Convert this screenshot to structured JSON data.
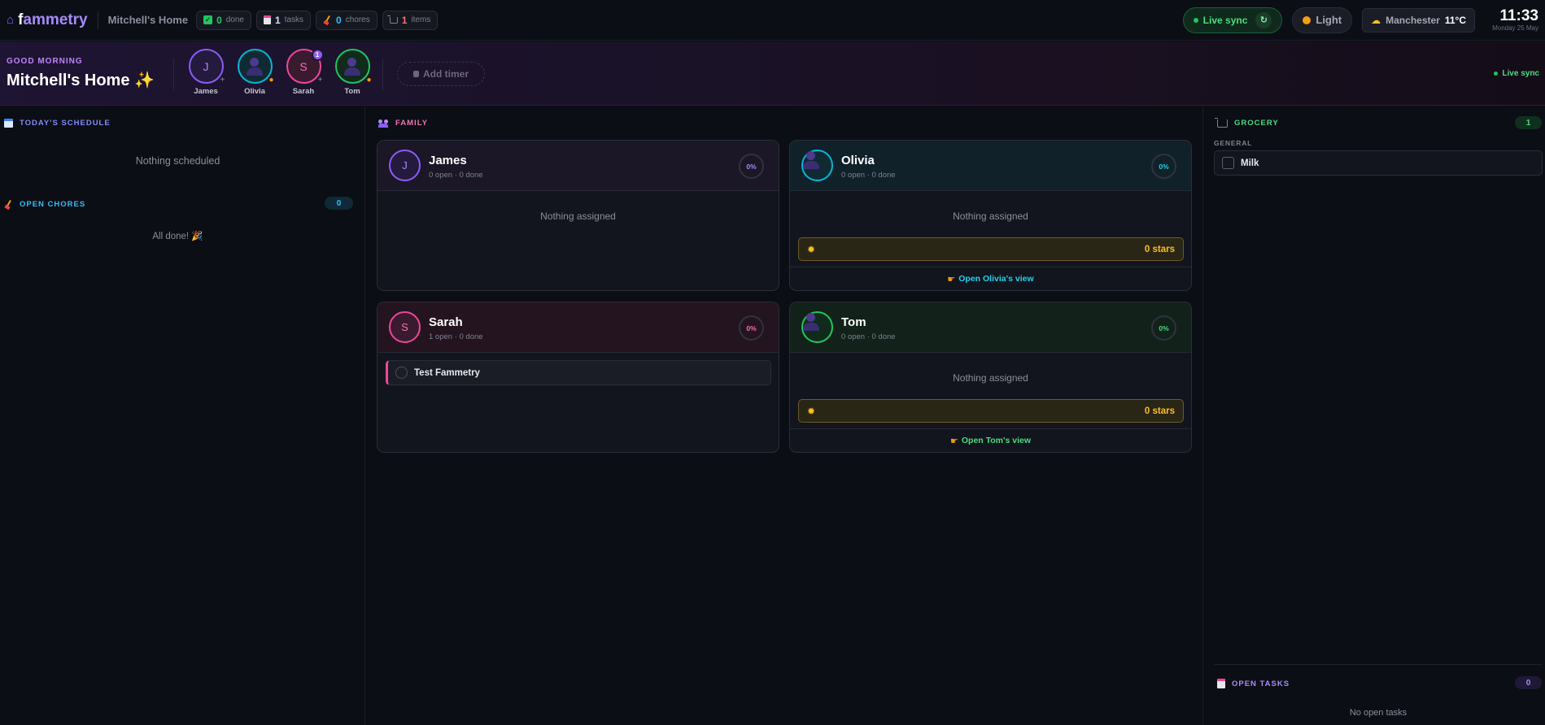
{
  "topbar": {
    "logo_f": "f",
    "logo_rest": "ammetry",
    "home_name": "Mitchell's Home",
    "stats": [
      {
        "value": "0",
        "label": "done",
        "color": "#22c55e"
      },
      {
        "value": "1",
        "label": "tasks",
        "color": "#c084fc"
      },
      {
        "value": "0",
        "label": "chores",
        "color": "#38bdf8"
      },
      {
        "value": "1",
        "label": "items",
        "color": "#f87171"
      }
    ],
    "live_sync": "Live sync",
    "theme": "Light",
    "weather_city": "Manchester",
    "weather_temp": "11°C",
    "time": "11:33",
    "date": "Monday 25 May"
  },
  "hero": {
    "greeting": "GOOD MORNING",
    "title": "Mitchell's Home ✨",
    "members": [
      {
        "name": "James",
        "initial": "J",
        "color": "#8b5cf6"
      },
      {
        "name": "Olivia",
        "initial": "",
        "color": "#06b6d4"
      },
      {
        "name": "Sarah",
        "initial": "S",
        "color": "#ec4899",
        "badge": "1"
      },
      {
        "name": "Tom",
        "initial": "",
        "color": "#22c55e"
      }
    ],
    "add_timer": "Add timer",
    "live_sync": "Live sync"
  },
  "left": {
    "schedule_title": "TODAY'S SCHEDULE",
    "schedule_empty": "Nothing scheduled",
    "chores_title": "OPEN CHORES",
    "chores_count": "0",
    "chores_empty": "All done! 🎉"
  },
  "family": {
    "title": "FAMILY",
    "cards": [
      {
        "name": "James",
        "initial": "J",
        "sub": "0 open · 0 done",
        "progress": "0%",
        "color": "#8b5cf6",
        "empty": "Nothing assigned"
      },
      {
        "name": "Olivia",
        "sub": "0 open · 0 done",
        "progress": "0%",
        "color": "#06b6d4",
        "empty": "Nothing assigned",
        "stars": "0 stars",
        "link": "Open Olivia's view"
      },
      {
        "name": "Sarah",
        "initial": "S",
        "sub": "1 open · 0 done",
        "progress": "0%",
        "color": "#ec4899",
        "task": "Test Fammetry"
      },
      {
        "name": "Tom",
        "sub": "0 open · 0 done",
        "progress": "0%",
        "color": "#22c55e",
        "empty": "Nothing assigned",
        "stars": "0 stars",
        "link": "Open Tom's view"
      }
    ]
  },
  "right": {
    "grocery_title": "GROCERY",
    "grocery_count": "1",
    "category": "GENERAL",
    "item": "Milk",
    "tasks_title": "OPEN TASKS",
    "tasks_count": "0",
    "tasks_empty": "No open tasks"
  }
}
